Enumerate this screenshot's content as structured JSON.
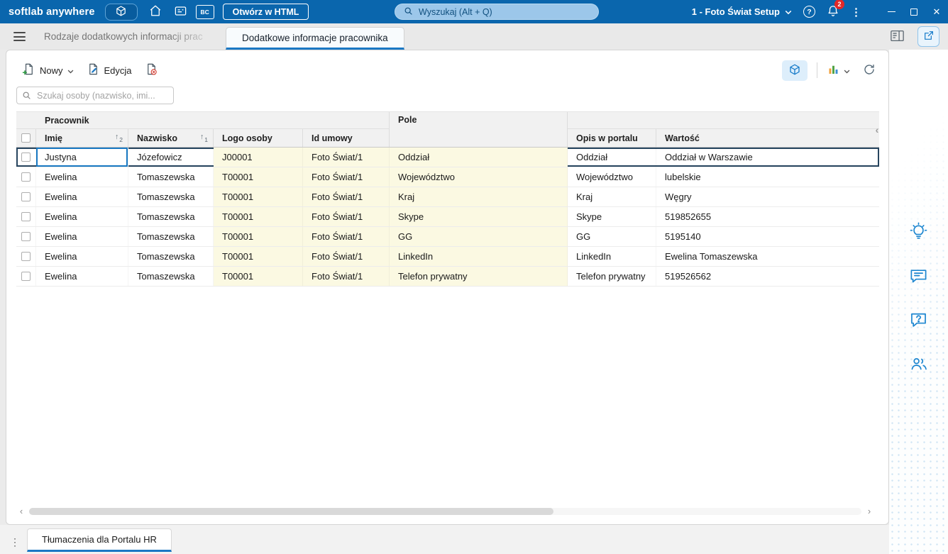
{
  "topbar": {
    "brand": "softlab anywhere",
    "bc_label": "BC",
    "open_in_html": "Otwórz w HTML",
    "search_placeholder": "Wyszukaj (Alt + Q)",
    "company": "1 - Foto Świat Setup",
    "notifications": "2"
  },
  "tabbar": {
    "inactive_tab": "Rodzaje dodatkowych informacji prac",
    "active_tab": "Dodatkowe informacje pracownika"
  },
  "toolbar": {
    "new": "Nowy",
    "edit": "Edycja"
  },
  "search": {
    "placeholder": "Szukaj osoby (nazwisko, imi..."
  },
  "table": {
    "group_pracownik": "Pracownik",
    "group_pole": "Pole",
    "col_imie": "Imię",
    "col_nazwisko": "Nazwisko",
    "col_logo": "Logo osoby",
    "col_id_umowy": "Id umowy",
    "col_opis": "Opis w portalu",
    "col_wartosc": "Wartość",
    "sort_imie_order": "2",
    "sort_nazwisko_order": "1",
    "rows": [
      {
        "imie": "Justyna",
        "nazwisko": "Józefowicz",
        "logo": "J00001",
        "id_umowy": "Foto Świat/1",
        "pole": "Oddział",
        "opis": "Oddział",
        "wartosc": "Oddział w Warszawie",
        "selected": true
      },
      {
        "imie": "Ewelina",
        "nazwisko": "Tomaszewska",
        "logo": "T00001",
        "id_umowy": "Foto Świat/1",
        "pole": "Województwo",
        "opis": "Województwo",
        "wartosc": "lubelskie",
        "selected": false
      },
      {
        "imie": "Ewelina",
        "nazwisko": "Tomaszewska",
        "logo": "T00001",
        "id_umowy": "Foto Świat/1",
        "pole": "Kraj",
        "opis": "Kraj",
        "wartosc": "Węgry",
        "selected": false
      },
      {
        "imie": "Ewelina",
        "nazwisko": "Tomaszewska",
        "logo": "T00001",
        "id_umowy": "Foto Świat/1",
        "pole": "Skype",
        "opis": "Skype",
        "wartosc": "519852655",
        "selected": false
      },
      {
        "imie": "Ewelina",
        "nazwisko": "Tomaszewska",
        "logo": "T00001",
        "id_umowy": "Foto Świat/1",
        "pole": "GG",
        "opis": "GG",
        "wartosc": "5195140",
        "selected": false
      },
      {
        "imie": "Ewelina",
        "nazwisko": "Tomaszewska",
        "logo": "T00001",
        "id_umowy": "Foto Świat/1",
        "pole": "LinkedIn",
        "opis": "LinkedIn",
        "wartosc": "Ewelina Tomaszewska",
        "selected": false
      },
      {
        "imie": "Ewelina",
        "nazwisko": "Tomaszewska",
        "logo": "T00001",
        "id_umowy": "Foto Świat/1",
        "pole": "Telefon prywatny",
        "opis": "Telefon prywatny",
        "wartosc": "519526562",
        "selected": false
      }
    ]
  },
  "bottom": {
    "tab": "Tłumaczenia dla Portalu HR"
  },
  "colors": {
    "topbar": "#0a66ad",
    "accent": "#1b78c4",
    "selection_border": "#27455f",
    "cell_highlight": "#fbf9e2",
    "badge": "#e12828"
  }
}
